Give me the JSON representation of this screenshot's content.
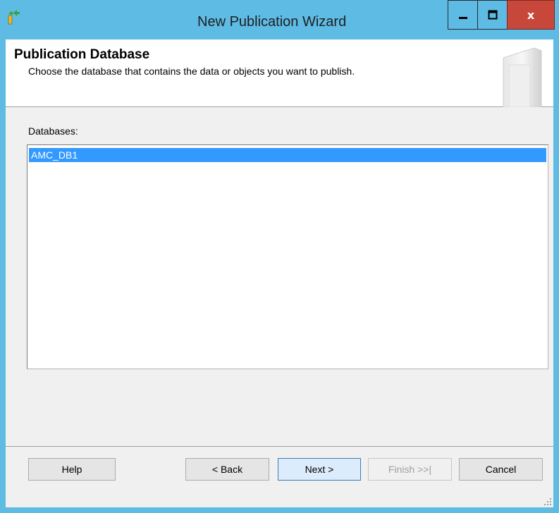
{
  "window": {
    "title": "New Publication Wizard",
    "controls": {
      "minimize": "minimize",
      "maximize": "maximize",
      "close": "x"
    }
  },
  "header": {
    "title": "Publication Database",
    "subtitle": "Choose the database that contains the data or objects you want to publish."
  },
  "databases": {
    "label": "Databases:",
    "items": [
      {
        "name": "AMC_DB1",
        "selected": true
      }
    ]
  },
  "buttons": {
    "help": "Help",
    "back": "< Back",
    "next": "Next >",
    "finish": "Finish >>|",
    "cancel": "Cancel"
  },
  "colors": {
    "titlebar": "#5ebbe4",
    "close": "#c7473a",
    "selection": "#3399ff"
  }
}
